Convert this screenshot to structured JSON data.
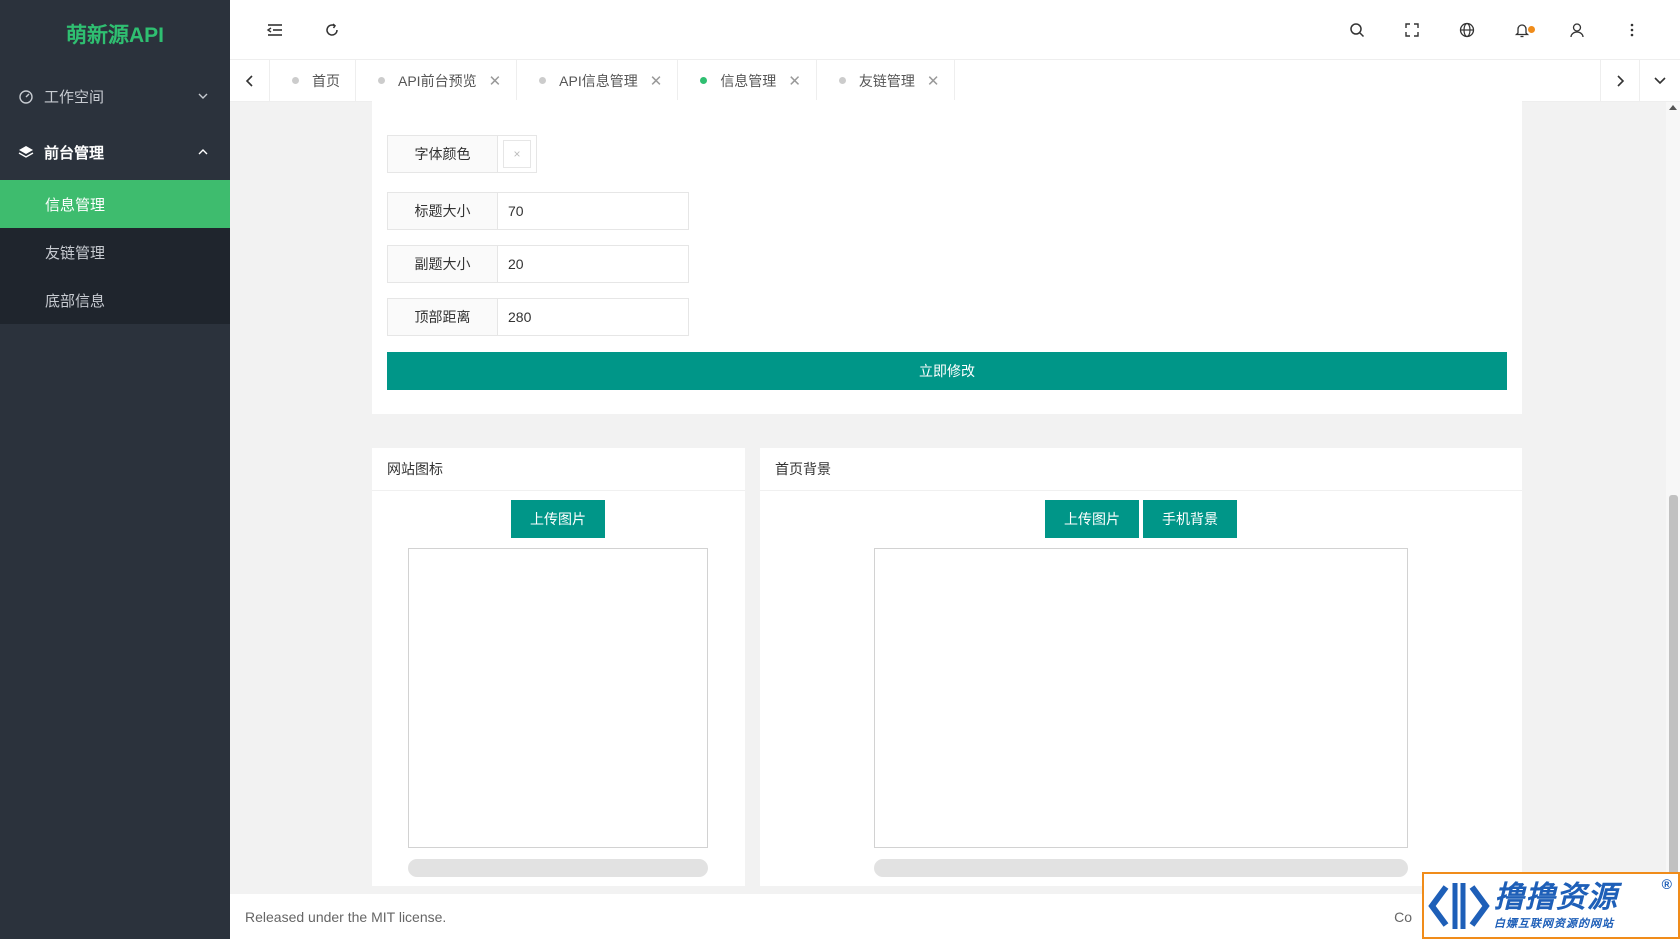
{
  "app": {
    "logo": "萌新源API"
  },
  "sidebar": {
    "groups": [
      {
        "label": "工作空间",
        "icon": "dashboard-icon",
        "expanded": false
      },
      {
        "label": "前台管理",
        "icon": "layers-icon",
        "expanded": true
      }
    ],
    "items": [
      {
        "label": "信息管理",
        "active": true
      },
      {
        "label": "友链管理",
        "active": false
      },
      {
        "label": "底部信息",
        "active": false
      }
    ]
  },
  "header": {
    "icons": [
      "menu-fold-icon",
      "refresh-icon",
      "search-icon",
      "fullscreen-icon",
      "globe-icon",
      "bell-icon",
      "user-icon",
      "more-vertical-icon"
    ]
  },
  "tabs": [
    {
      "label": "首页",
      "closable": false,
      "active": false
    },
    {
      "label": "API前台预览",
      "closable": true,
      "active": false
    },
    {
      "label": "API信息管理",
      "closable": true,
      "active": false
    },
    {
      "label": "信息管理",
      "closable": true,
      "active": true
    },
    {
      "label": "友链管理",
      "closable": true,
      "active": false
    }
  ],
  "form": {
    "font_color_label": "字体颜色",
    "font_color_clear": "×",
    "title_size_label": "标题大小",
    "title_size_value": "70",
    "subtitle_size_label": "副题大小",
    "subtitle_size_value": "20",
    "top_margin_label": "顶部距离",
    "top_margin_value": "280",
    "submit_label": "立即修改"
  },
  "site_icon": {
    "title": "网站图标",
    "upload_label": "上传图片"
  },
  "home_bg": {
    "title": "首页背景",
    "upload_label": "上传图片",
    "mobile_label": "手机背景"
  },
  "footer": {
    "license": "Released under the MIT license.",
    "right_text": "Co"
  },
  "watermark": {
    "title": "撸撸资源",
    "subtitle": "白嫖互联网资源的网站",
    "reg": "®"
  },
  "colors": {
    "sidebar_bg": "#2b323c",
    "accent_green": "#3ebc6e",
    "teal_button": "#009688",
    "notify_dot": "#f08c1a"
  }
}
